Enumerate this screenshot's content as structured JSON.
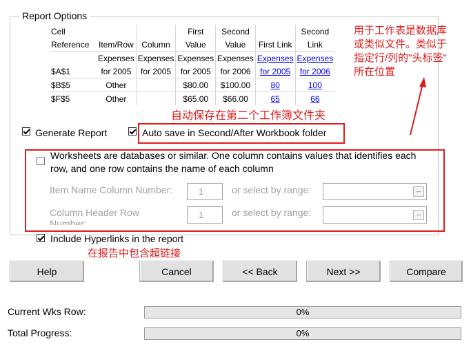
{
  "report_options": {
    "title": "Report Options",
    "table": {
      "header_rows": [
        [
          "Cell",
          "",
          "",
          "First",
          "Second",
          "",
          "Second"
        ],
        [
          "Reference",
          "Item/Row",
          "Column",
          "Value",
          "Value",
          "First Link",
          "Link"
        ],
        [
          "",
          "Expenses",
          "Expenses",
          "Expenses",
          "Expenses",
          "Expenses",
          "Expenses"
        ],
        [
          "$A$1",
          "for 2005",
          "for 2005",
          "for 2005",
          "for 2006",
          "for 2005",
          "for 2006"
        ]
      ],
      "rows": [
        [
          "$B$5",
          "Other",
          "",
          "$80.00",
          "$100.00",
          "80",
          "100"
        ],
        [
          "$F$5",
          "Other",
          "",
          "$65.00",
          "$66.00",
          "65",
          "66"
        ]
      ]
    },
    "generate_report": {
      "label": "Generate Report",
      "checked": true
    },
    "auto_save": {
      "label": "Auto save in Second/After Workbook folder",
      "checked": true
    },
    "worksheets_db": {
      "label_line1": "Worksheets are databases or similar. One column contains values that identifies each",
      "label_line2": "row, and one row contains the name of each column",
      "checked": false
    },
    "item_name_col": {
      "label": "Item Name Column Number:",
      "value": "1",
      "range_label": "or select by range:"
    },
    "col_header_row": {
      "label": "Column Header Row",
      "label_cut": "Number:",
      "value": "1",
      "range_label": "or select by range:"
    },
    "hyperlinks": {
      "label": "Include Hyperlinks in the report",
      "checked": true
    }
  },
  "buttons": {
    "help": "Help",
    "cancel": "Cancel",
    "back": "<< Back",
    "next": "Next >>",
    "compare": "Compare"
  },
  "progress": {
    "current_wks_row": {
      "label": "Current Wks Row:",
      "percent": 0,
      "text": "0%"
    },
    "total": {
      "label": "Total Progress:",
      "percent": 0,
      "text": "0%"
    }
  },
  "annotations": {
    "auto_save_note": "自动保存在第二个工作簿文件夹",
    "hyperlinks_note": "在报告中包含超链接",
    "header_note_lines": [
      "用于工作表是数据库",
      "或类似文件。类似于",
      "指定行/列的\"头标签\"",
      "所在位置"
    ],
    "color": "#e01b1b"
  }
}
